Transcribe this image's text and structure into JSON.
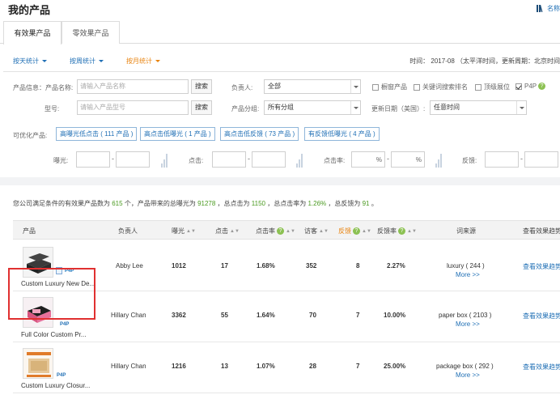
{
  "header": {
    "title": "我的产品",
    "top_right_text": "名称"
  },
  "tabs": [
    {
      "label": "有效果产品",
      "active": true
    },
    {
      "label": "零效果产品",
      "active": false
    }
  ],
  "stats_links": [
    {
      "label": "按天统计"
    },
    {
      "label": "按周统计"
    },
    {
      "label": "按月统计"
    }
  ],
  "time_info": "时间： 2017-08 （太平洋时间，更新周期：北京时间",
  "filters": {
    "product_info_label": "产品信息：",
    "product_name_label": "产品名称:",
    "product_name_placeholder": "请输入产品名称",
    "search_label": "搜索",
    "owner_label": "负责人:",
    "owner_value": "全部",
    "cb_window_product": "橱窗产品",
    "cb_keyword_rank": "关键词搜索排名",
    "cb_top_display": "顶级展位",
    "cb_p4p": "P4P",
    "model_label": "型号:",
    "model_placeholder": "请输入产品型号",
    "group_label": "产品分组:",
    "group_value": "所有分组",
    "update_date_label": "更新日期（美国）:",
    "update_date_value": "任意时间",
    "optimizable_label": "可优化产品:",
    "chips": [
      "高曝光低点击 ( 111 产品 )",
      "高点击低曝光 ( 1 产品 )",
      "高点击低反馈 ( 73 产品 )",
      "有反馈低曝光 ( 4 产品 )"
    ],
    "exposure_label": "曝光:",
    "click_label": "点击:",
    "ctr_label": "点击率:",
    "feedback_label": "反馈:",
    "percent": "%",
    "dash": "-"
  },
  "summary": {
    "prefix": "您公司满足条件的有效果产品数为",
    "count": "615",
    "part2": "个，产品带来的总曝光为",
    "exposure": "91278",
    "part3": "，总点击为",
    "clicks": "1150",
    "part4": "，总点击率为",
    "ctr": "1.26%",
    "part5": "，总反馈为",
    "feedback": "91",
    "suffix": "。"
  },
  "table": {
    "headers": {
      "product": "产品",
      "owner": "负责人",
      "exposure": "曝光",
      "clicks": "点击",
      "ctr": "点击率",
      "visitors": "访客",
      "feedback": "反馈",
      "feedback_rate": "反馈率",
      "keyword_source": "词来源",
      "trend": "查看效果趋势"
    },
    "rows": [
      {
        "name": "Custom Luxury New De...",
        "owner": "Abby Lee",
        "exposure": "1012",
        "clicks": "17",
        "ctr": "1.68%",
        "visitors": "352",
        "feedback": "8",
        "feedback_rate": "2.27%",
        "keyword": "luxury ( 244 )",
        "more": "More >>",
        "trend": "查看效果趋势",
        "badge": "P4P"
      },
      {
        "name": "Full Color Custom Pr...",
        "owner": "Hillary Chan",
        "exposure": "3362",
        "clicks": "55",
        "ctr": "1.64%",
        "visitors": "70",
        "feedback": "7",
        "feedback_rate": "10.00%",
        "keyword": "paper box ( 2103 )",
        "more": "More >>",
        "trend": "查看效果趋势",
        "badge": "P4P"
      },
      {
        "name": "Custom Luxury Closur...",
        "owner": "Hillary Chan",
        "exposure": "1216",
        "clicks": "13",
        "ctr": "1.07%",
        "visitors": "28",
        "feedback": "7",
        "feedback_rate": "25.00%",
        "keyword": "package box ( 292 )",
        "more": "More >>",
        "trend": "查看效果趋势",
        "badge": "P4P"
      }
    ]
  },
  "colors": {
    "link_blue": "#1f6fb5",
    "accent_orange": "#e8830f",
    "summary_green": "#4a9a20",
    "highlight_red": "#e03030"
  }
}
